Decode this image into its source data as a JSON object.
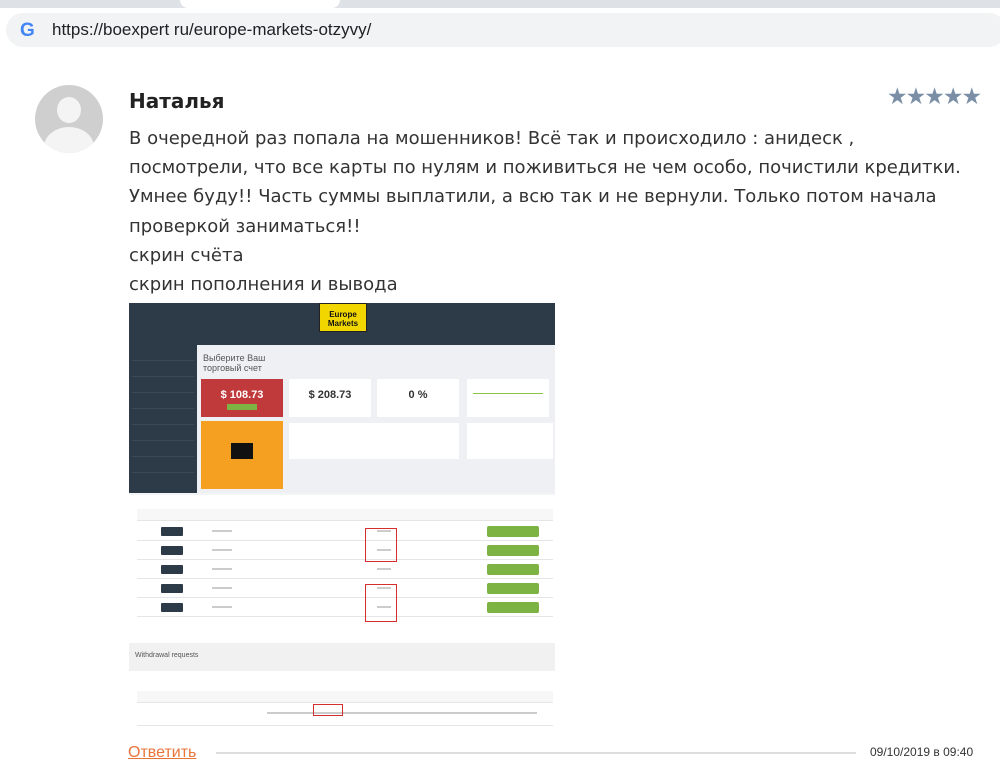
{
  "browser": {
    "url": "https://boexpert ru/europe-markets-otzyvy/",
    "icon": "google-icon"
  },
  "comment": {
    "author": "Наталья",
    "rating": 5,
    "rating_max": 5,
    "lines": [
      "В очередной раз попала на мошенников! Всё так и происходило : анидеск ,",
      "посмотрели, что все карты по нулям и поживиться не чем особо, почистили кредитки.",
      "Умнее буду!! Часть суммы выплатили, а всю так и не вернули. Только потом начала",
      "проверкой заниматься!!",
      "скрин счёта",
      "скрин пополнения и вывода"
    ],
    "reply_label": "Ответить",
    "date": "09/10/2019 в 09:40"
  },
  "screenshot": {
    "logo": "Europe Markets",
    "title": "Выберите Ваш торговый счет",
    "balance": "$ 108.73",
    "funds": "$ 208.73",
    "margin_level": "0 %",
    "withdrawal_title": "Withdrawal requests"
  },
  "colors": {
    "accent": "#e8743b",
    "stars": "#7a8fa6"
  }
}
